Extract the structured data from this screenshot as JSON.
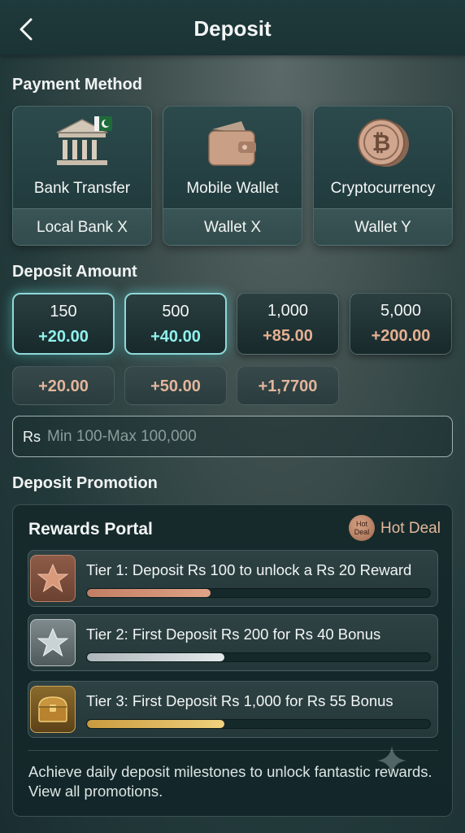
{
  "header": {
    "title": "Deposit",
    "back_icon": "chevron-left-icon"
  },
  "payment_method": {
    "section_title": "Payment Method",
    "options": [
      {
        "label": "Bank Transfer",
        "sub": "Local Bank X",
        "icon": "bank-icon"
      },
      {
        "label": "Mobile Wallet",
        "sub": "Wallet X",
        "icon": "wallet-icon"
      },
      {
        "label": "Cryptocurrency",
        "sub": "Wallet Y",
        "icon": "bitcoin-icon"
      }
    ]
  },
  "deposit_amount": {
    "section_title": "Deposit Amount",
    "presets": [
      {
        "amount": "150",
        "bonus": "+20.00",
        "selected": true
      },
      {
        "amount": "500",
        "bonus": "+40.00",
        "selected": true
      },
      {
        "amount": "1,000",
        "bonus": "+85.00",
        "selected": false
      },
      {
        "amount": "5,000",
        "bonus": "+200.00",
        "selected": false
      }
    ],
    "bonus_chips": [
      "+20.00",
      "+50.00",
      "+1,7700"
    ],
    "input": {
      "prefix": "Rs",
      "placeholder": "Min 100-Max 100,000",
      "value": ""
    }
  },
  "promotion": {
    "section_title": "Deposit Promotion",
    "panel_title": "Rewards Portal",
    "badge_text": "Hot Deal",
    "badge_label": "Hot Deal",
    "tiers": [
      {
        "text": "Tier 1: Deposit Rs 100 to unlock a Rs 20 Reward",
        "icon": "star-bronze-icon",
        "progress": 0.36
      },
      {
        "text": "Tier 2: First Deposit Rs 200 for Rs 40 Bonus",
        "icon": "star-silver-icon",
        "progress": 0.4
      },
      {
        "text": "Tier 3: First Deposit Rs 1,000 for Rs 55 Bonus",
        "icon": "treasure-chest-icon",
        "progress": 0.4
      }
    ],
    "description": "Achieve daily deposit milestones to unlock fantastic rewards. View all promotions."
  },
  "colors": {
    "accent_teal": "#8ff0ec",
    "bonus_bronze": "#e5b092",
    "tier1_fill": "#d98f72",
    "tier2_fill": "#c9cfd2",
    "tier3_fill": "#e0b860"
  }
}
